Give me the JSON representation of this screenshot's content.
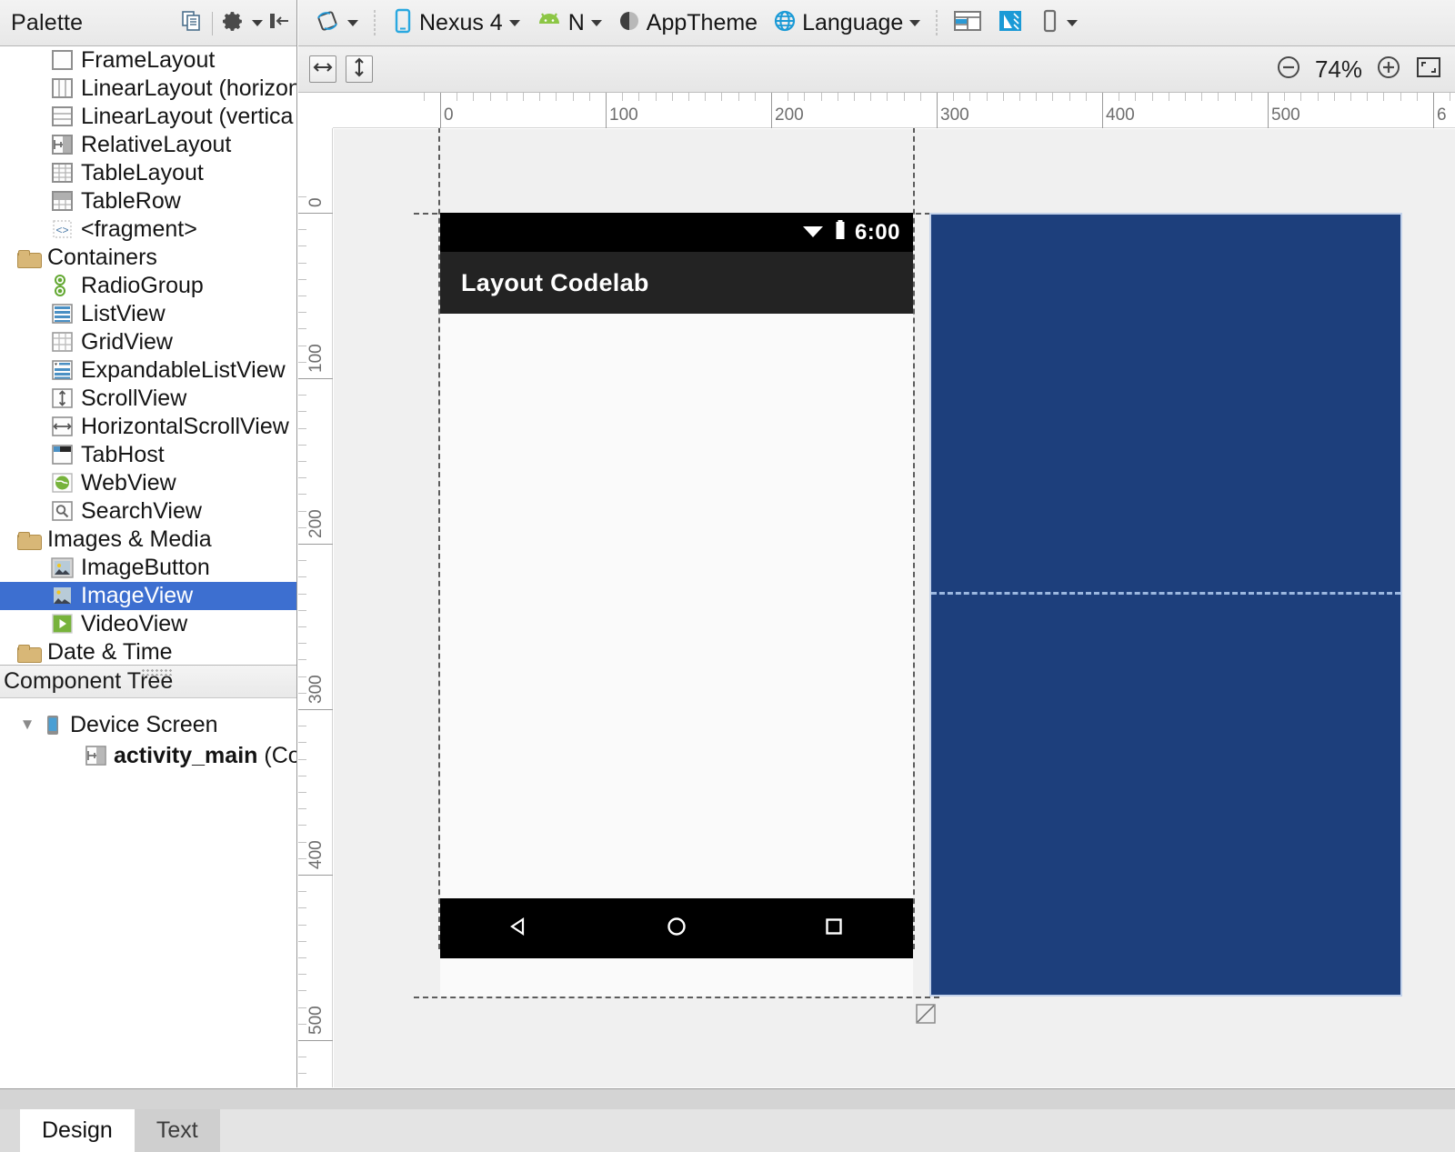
{
  "palette": {
    "title": "Palette",
    "header_icons": [
      "copy-icon",
      "gear-icon",
      "collapse-panel-icon"
    ],
    "items": [
      {
        "label": "FrameLayout",
        "icon": "frame-layout-icon",
        "type": "item"
      },
      {
        "label": "LinearLayout (horizon",
        "icon": "linear-layout-horizontal-icon",
        "type": "item"
      },
      {
        "label": "LinearLayout (vertica",
        "icon": "linear-layout-vertical-icon",
        "type": "item"
      },
      {
        "label": "RelativeLayout",
        "icon": "relative-layout-icon",
        "type": "item"
      },
      {
        "label": "TableLayout",
        "icon": "table-layout-icon",
        "type": "item"
      },
      {
        "label": "TableRow",
        "icon": "table-row-icon",
        "type": "item"
      },
      {
        "label": "<fragment>",
        "icon": "fragment-icon",
        "type": "item"
      },
      {
        "label": "Containers",
        "icon": "folder-icon",
        "type": "group"
      },
      {
        "label": "RadioGroup",
        "icon": "radio-group-icon",
        "type": "item"
      },
      {
        "label": "ListView",
        "icon": "list-view-icon",
        "type": "item"
      },
      {
        "label": "GridView",
        "icon": "grid-view-icon",
        "type": "item"
      },
      {
        "label": "ExpandableListView",
        "icon": "expandable-list-view-icon",
        "type": "item"
      },
      {
        "label": "ScrollView",
        "icon": "scroll-view-icon",
        "type": "item"
      },
      {
        "label": "HorizontalScrollView",
        "icon": "horizontal-scroll-view-icon",
        "type": "item"
      },
      {
        "label": "TabHost",
        "icon": "tab-host-icon",
        "type": "item"
      },
      {
        "label": "WebView",
        "icon": "web-view-icon",
        "type": "item"
      },
      {
        "label": "SearchView",
        "icon": "search-view-icon",
        "type": "item"
      },
      {
        "label": "Images & Media",
        "icon": "folder-icon",
        "type": "group"
      },
      {
        "label": "ImageButton",
        "icon": "image-button-icon",
        "type": "item"
      },
      {
        "label": "ImageView",
        "icon": "image-view-icon",
        "type": "item",
        "selected": true
      },
      {
        "label": "VideoView",
        "icon": "video-view-icon",
        "type": "item"
      },
      {
        "label": "Date & Time",
        "icon": "folder-icon",
        "type": "group"
      }
    ],
    "selection_color": "#3d6fd0"
  },
  "component_tree": {
    "title": "Component Tree",
    "nodes": [
      {
        "label": "Device Screen",
        "icon": "device-screen-icon",
        "expanded": true,
        "bold": false
      },
      {
        "label": "activity_main",
        "suffix": " (Co",
        "icon": "relative-layout-icon",
        "bold": true
      }
    ]
  },
  "toolbar": {
    "orientation_label": "",
    "device_label": "Nexus 4",
    "api_label": "N",
    "theme_label": "AppTheme",
    "language_label": "Language",
    "icons": [
      "orientation-rotate-icon",
      "device-phone-icon",
      "android-api-icon",
      "theme-contrast-icon",
      "globe-icon",
      "layout-variants-icon",
      "blueprint-mode-icon",
      "device-list-icon"
    ]
  },
  "toolbar2": {
    "fill_width_icon": "arrow-horizontal-icon",
    "fill_height_icon": "arrow-vertical-icon",
    "zoom_out_icon": "zoom-out-icon",
    "zoom_level": "74%",
    "zoom_in_icon": "zoom-in-icon",
    "zoom_fit_icon": "zoom-fit-icon"
  },
  "rulers": {
    "horizontal_labels": [
      "0",
      "100",
      "200",
      "300",
      "400",
      "500",
      "6"
    ],
    "vertical_labels": [
      "0",
      "100",
      "200",
      "300",
      "400",
      "500"
    ],
    "unit_step": 100
  },
  "device_preview": {
    "app_bar_title": "Layout Codelab",
    "status_clock": "6:00",
    "status_icons": [
      "wifi-icon",
      "battery-icon"
    ],
    "nav_icons": [
      "nav-back-icon",
      "nav-home-icon",
      "nav-recents-icon"
    ],
    "background_color": "#fafafa",
    "app_bar_color": "#232323",
    "status_bar_color": "#000000"
  },
  "drag_overlay": {
    "fill_color": "#1d3f7c",
    "border_color": "#c3d2ea",
    "guide_color": "#9cb8e0"
  },
  "bottom_tabs": [
    {
      "label": "Design",
      "active": true
    },
    {
      "label": "Text",
      "active": false
    }
  ]
}
